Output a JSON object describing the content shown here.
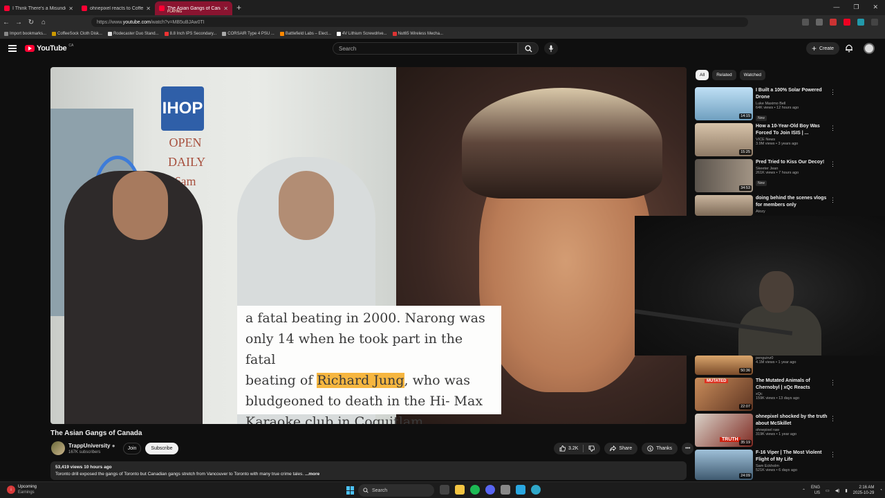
{
  "browser": {
    "tabs": [
      {
        "title": "I Think There's a Misunderstan",
        "subtitle": ""
      },
      {
        "title": "ohnepixel reacts to Coffeezilla's",
        "subtitle": ""
      },
      {
        "title": "The Asian Gangs of Canada - Y",
        "subtitle": "PLAYING"
      }
    ],
    "url_prefix": "https://www.",
    "url_domain": "youtube.com",
    "url_path": "/watch?v=MB5uBJAw0TI",
    "bookmarks": [
      "Import bookmarks...",
      "CoffeeSock Cloth Disk...",
      "Rodecaster Duo Stand...",
      "8.8 Inch IPS Secondary...",
      "CORSAIR Type 4 PSU ...",
      "Battlefield Labs – Elect...",
      "4V Lithium Screwdrive...",
      "Nut65 Wireless Mecha..."
    ]
  },
  "youtube": {
    "logo": "YouTube",
    "region": "CA",
    "search_placeholder": "Search",
    "create_label": "Create"
  },
  "video": {
    "caption_line1": "a fatal beating in 2000. Narong was",
    "caption_line2": "only 14 when he took part in the fatal",
    "caption_line3_pre": "beating of ",
    "caption_highlight": "Richard Jung",
    "caption_line3_post": ", who was",
    "caption_line4": "bludgeoned to death in the Hi- Max",
    "caption_line5": "Karaoke club in Coquitlam.",
    "sign_ihop": "IHOP",
    "sign_open": "OPEN DAILY 6am",
    "title": "The Asian Gangs of Canada",
    "channel": "TrappUniversity",
    "subscribers": "167K subscribers",
    "join": "Join",
    "subscribe": "Subscribe",
    "likes": "3.2K",
    "share": "Share",
    "thanks": "Thanks",
    "views_time": "53,419 views  10 hours ago",
    "description": "Toronto drill exposed the gangs of Toronto but Canadian gangs stretch from Vancouver to Toronto with many true crime tales.",
    "more": "...more"
  },
  "sidebar": {
    "chips": [
      "All",
      "Related",
      "Watched"
    ],
    "recs": [
      {
        "title": "I Built a 100% Solar Powered Drone",
        "channel": "Luke Maximo Bell",
        "meta": "64K views • 12 hours ago",
        "badge": "New",
        "duration": "14:15",
        "thumb_color": "#8fb9d8"
      },
      {
        "title": "How a 10-Year-Old Boy Was Forced To Join ISIS | ...",
        "channel": "VICE News",
        "meta": "3.9M views • 3 years ago",
        "badge": "",
        "duration": "15:25",
        "thumb_color": "#c7b49c"
      },
      {
        "title": "Pred Tried to Kiss Our Decoy!",
        "channel": "Skeeter Jean",
        "meta": "261K views • 7 hours ago",
        "badge": "New",
        "duration": "34:53",
        "thumb_color": "#7a7066"
      },
      {
        "title": "doing behind the scenes vlogs for members only",
        "channel": "Atozy",
        "meta": "",
        "badge": "",
        "duration": "",
        "thumb_color": "#b3a08a"
      },
      {
        "title": "",
        "channel": "penguinz0",
        "meta": "4.1M views • 1 year ago",
        "badge": "",
        "duration": "50:36",
        "thumb_color": "#b4824c"
      },
      {
        "title": "The Mutated Animals of Chernobyl | xQc Reacts",
        "channel": "xQc",
        "meta": "159K views • 13 days ago",
        "badge": "",
        "duration": "22:07",
        "thumb_color": "#a86a43",
        "thumb_label": "MUTATED"
      },
      {
        "title": "ohnepixel shocked by the truth about McSkillet",
        "channel": "ohnepixel raw",
        "meta": "319K views • 1 year ago",
        "badge": "",
        "duration": "35:19",
        "thumb_color": "#9a3b33",
        "thumb_label": "TRUTH"
      },
      {
        "title": "F-16 Viper | The Most Violent Flight of My Life",
        "channel": "Sam Eckholm",
        "meta": "521K views • 6 days ago",
        "badge": "New",
        "duration": "24:09",
        "thumb_color": "#5e7f9b"
      }
    ]
  },
  "taskbar": {
    "weather_title": "Upcoming",
    "weather_sub": "Earnings",
    "search": "Search",
    "lang_top": "ENG",
    "lang_bottom": "US",
    "time": "2:16 AM",
    "date": "2025-10-29"
  },
  "colors": {
    "accent": "#ff0033",
    "tab_active": "#8a1430",
    "highlight": "#f6b640"
  }
}
